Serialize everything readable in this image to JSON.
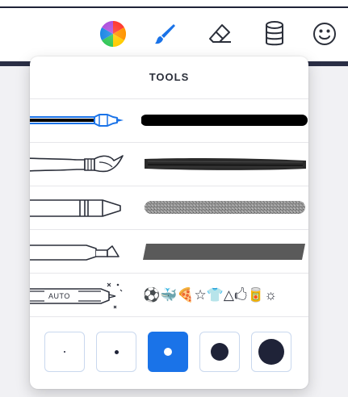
{
  "toolbar": {
    "icons": [
      "color-wheel-icon",
      "brush-icon",
      "eraser-icon",
      "bucket-icon",
      "emoji-icon"
    ],
    "accent_color": "#1a73e8"
  },
  "panel": {
    "title": "TOOLS",
    "tools": [
      {
        "name": "marker",
        "selected": true
      },
      {
        "name": "paintbrush",
        "selected": false
      },
      {
        "name": "crayon",
        "selected": false
      },
      {
        "name": "highlighter",
        "selected": false
      },
      {
        "name": "auto-shapes",
        "selected": false,
        "label": "AUTO",
        "shapes_preview": "⚽🐳🍕☆👕△🖒🥫☼"
      }
    ],
    "sizes": [
      {
        "name": "extra-small",
        "selected": false
      },
      {
        "name": "small",
        "selected": false
      },
      {
        "name": "medium",
        "selected": true
      },
      {
        "name": "large",
        "selected": false
      },
      {
        "name": "extra-large",
        "selected": false
      }
    ]
  }
}
